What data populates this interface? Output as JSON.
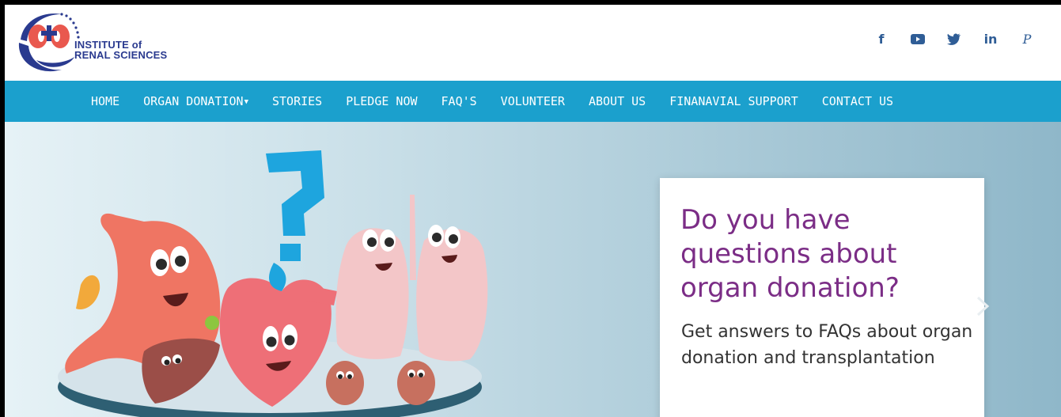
{
  "header": {
    "logo": {
      "line1": "INSTITUTE of",
      "line2": "RENAL SCIENCES"
    },
    "social": [
      {
        "icon": "facebook-icon",
        "glyph": "f"
      },
      {
        "icon": "youtube-icon",
        "glyph": "▶"
      },
      {
        "icon": "twitter-icon",
        "glyph": "t"
      },
      {
        "icon": "linkedin-icon",
        "glyph": "in"
      },
      {
        "icon": "pinterest-icon",
        "glyph": "P"
      }
    ]
  },
  "nav": {
    "items": [
      {
        "label": "HOME"
      },
      {
        "label": "ORGAN DONATION",
        "dropdown": true
      },
      {
        "label": "STORIES"
      },
      {
        "label": "PLEDGE NOW"
      },
      {
        "label": "FAQ'S"
      },
      {
        "label": "VOLUNTEER"
      },
      {
        "label": "ABOUT US"
      },
      {
        "label": "FINANAVIAL SUPPORT"
      },
      {
        "label": "CONTACT US"
      }
    ]
  },
  "hero": {
    "heading": "Do you have questions about organ donation?",
    "subtext": "Get answers to FAQs about organ donation and transplantation"
  },
  "colors": {
    "nav_bg": "#1ba0cd",
    "heading": "#7b2d86",
    "brand_blue": "#2a3a8f",
    "social": "#2f5d96"
  }
}
